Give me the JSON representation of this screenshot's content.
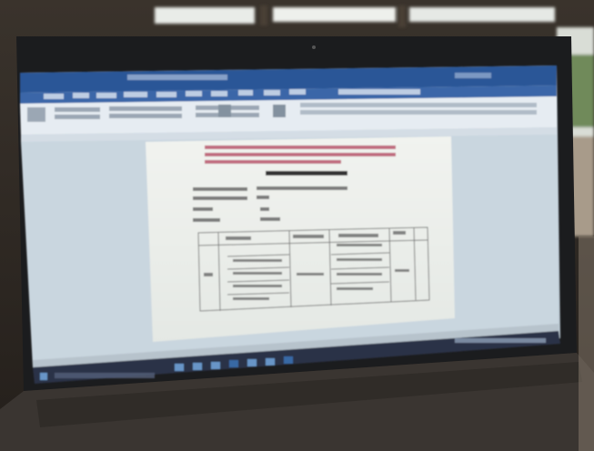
{
  "photo": {
    "subject": "laptop-displaying-word-processor-document",
    "colors": {
      "room": "#2f2a25",
      "window_light": "#e9ece8",
      "foliage": "#6f8a5a",
      "bezel": "#1b1c1e",
      "titlebar": "#2b5797",
      "ribbon": "#e6ecf2",
      "workspace": "#c9d6df",
      "page": "#eef1ee",
      "highlight_text": "#b0405a",
      "taskbar": "#2a3346",
      "desk": "#3a3531"
    }
  },
  "screen": {
    "title_text": "",
    "status_text": ""
  }
}
